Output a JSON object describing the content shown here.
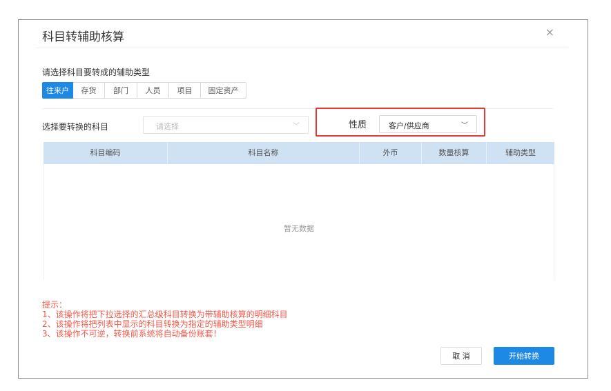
{
  "dialog": {
    "title": "科目转辅助核算",
    "close_icon": "×"
  },
  "subtitle": "请选择科目要转成的辅助类型",
  "tabs": [
    {
      "label": "往来户",
      "active": true
    },
    {
      "label": "存货",
      "active": false
    },
    {
      "label": "部门",
      "active": false
    },
    {
      "label": "人员",
      "active": false
    },
    {
      "label": "项目",
      "active": false
    },
    {
      "label": "固定资产",
      "active": false
    }
  ],
  "subject_select": {
    "label": "选择要转换的科目",
    "placeholder": "请选择",
    "chevron": "﹀"
  },
  "nature": {
    "label": "性质",
    "value": "客户/供应商",
    "chevron": "﹀"
  },
  "table": {
    "headers": [
      "科目编码",
      "科目名称",
      "外币",
      "数量核算",
      "辅助类型"
    ],
    "empty_text": "暂无数据"
  },
  "notes": [
    "提示：",
    "1、该操作将把下拉选择的汇总级科目转换为带辅助核算的明细科目",
    "2、该操作将把列表中显示的科目转换为指定的辅助类型明细",
    "3、该操作不可逆，转换前系统将自动备份账套！"
  ],
  "buttons": {
    "cancel": "取 消",
    "start": "开始转换"
  },
  "colors": {
    "primary": "#1e88e5",
    "header_bg": "#cfe2f3",
    "warning": "#f05a4b",
    "highlight_border": "#e53935"
  }
}
